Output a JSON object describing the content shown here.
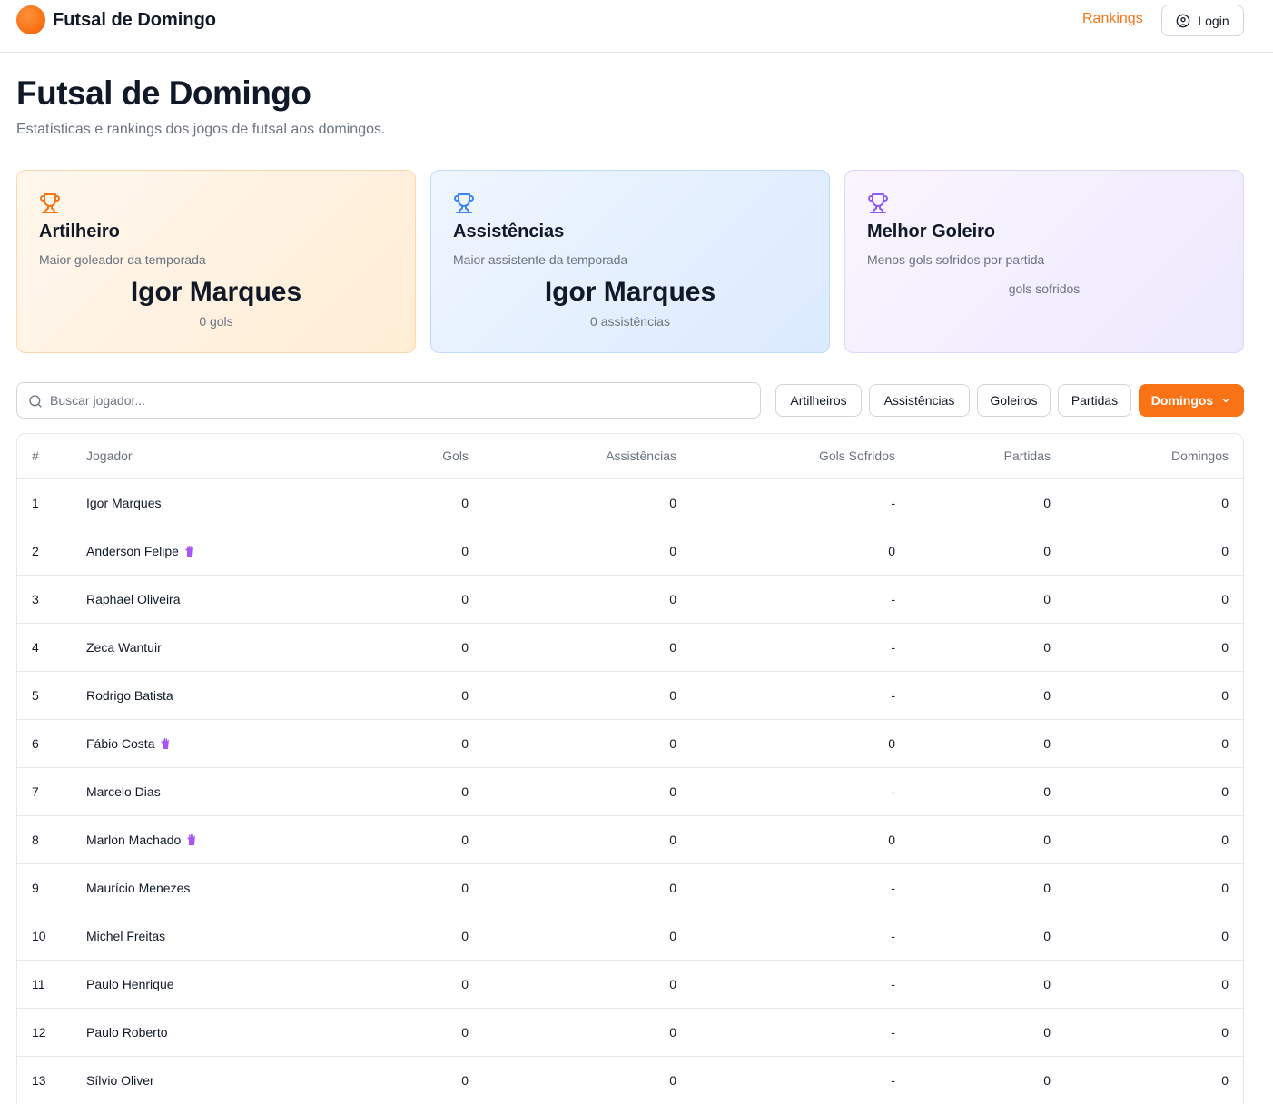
{
  "header": {
    "brand": "Futsal de Domingo",
    "nav_rankings": "Rankings",
    "login_label": "Login"
  },
  "page": {
    "title": "Futsal de Domingo",
    "subtitle": "Estatísticas e rankings dos jogos de futsal aos domingos."
  },
  "cards": {
    "scorer": {
      "title": "Artilheiro",
      "desc": "Maior goleador da temporada",
      "player": "Igor Marques",
      "stat": "0 gols",
      "icon": "trophy-icon",
      "color": "#f97316"
    },
    "assists": {
      "title": "Assistências",
      "desc": "Maior assistente da temporada",
      "player": "Igor Marques",
      "stat": "0 assistências",
      "icon": "trophy-icon",
      "color": "#3b82f6"
    },
    "keeper": {
      "title": "Melhor Goleiro",
      "desc": "Menos gols sofridos por partida",
      "player": "",
      "stat": "gols sofridos",
      "icon": "trophy-icon",
      "color": "#8b5cf6"
    }
  },
  "search": {
    "placeholder": "Buscar jogador..."
  },
  "filters": [
    "Artilheiros",
    "Assistências",
    "Goleiros",
    "Partidas",
    "Domingos"
  ],
  "active_filter": "Domingos",
  "table": {
    "headers": [
      "#",
      "Jogador",
      "Gols",
      "Assistências",
      "Gols Sofridos",
      "Partidas",
      "Domingos"
    ],
    "rows": [
      {
        "rank": "1",
        "name": "Igor Marques",
        "keeper": false,
        "goals": "0",
        "assists": "0",
        "conceded": "-",
        "matches": "0",
        "sundays": "0"
      },
      {
        "rank": "2",
        "name": "Anderson Felipe",
        "keeper": true,
        "goals": "0",
        "assists": "0",
        "conceded": "0",
        "matches": "0",
        "sundays": "0"
      },
      {
        "rank": "3",
        "name": "Raphael Oliveira",
        "keeper": false,
        "goals": "0",
        "assists": "0",
        "conceded": "-",
        "matches": "0",
        "sundays": "0"
      },
      {
        "rank": "4",
        "name": "Zeca Wantuir",
        "keeper": false,
        "goals": "0",
        "assists": "0",
        "conceded": "-",
        "matches": "0",
        "sundays": "0"
      },
      {
        "rank": "5",
        "name": "Rodrigo Batista",
        "keeper": false,
        "goals": "0",
        "assists": "0",
        "conceded": "-",
        "matches": "0",
        "sundays": "0"
      },
      {
        "rank": "6",
        "name": "Fábio Costa",
        "keeper": true,
        "goals": "0",
        "assists": "0",
        "conceded": "0",
        "matches": "0",
        "sundays": "0"
      },
      {
        "rank": "7",
        "name": "Marcelo Dias",
        "keeper": false,
        "goals": "0",
        "assists": "0",
        "conceded": "-",
        "matches": "0",
        "sundays": "0"
      },
      {
        "rank": "8",
        "name": "Marlon Machado",
        "keeper": true,
        "goals": "0",
        "assists": "0",
        "conceded": "0",
        "matches": "0",
        "sundays": "0"
      },
      {
        "rank": "9",
        "name": "Maurício Menezes",
        "keeper": false,
        "goals": "0",
        "assists": "0",
        "conceded": "-",
        "matches": "0",
        "sundays": "0"
      },
      {
        "rank": "10",
        "name": "Michel Freitas",
        "keeper": false,
        "goals": "0",
        "assists": "0",
        "conceded": "-",
        "matches": "0",
        "sundays": "0"
      },
      {
        "rank": "11",
        "name": "Paulo Henrique",
        "keeper": false,
        "goals": "0",
        "assists": "0",
        "conceded": "-",
        "matches": "0",
        "sundays": "0"
      },
      {
        "rank": "12",
        "name": "Paulo Roberto",
        "keeper": false,
        "goals": "0",
        "assists": "0",
        "conceded": "-",
        "matches": "0",
        "sundays": "0"
      },
      {
        "rank": "13",
        "name": "Sílvio Oliver",
        "keeper": false,
        "goals": "0",
        "assists": "0",
        "conceded": "-",
        "matches": "0",
        "sundays": "0"
      }
    ]
  },
  "colors": {
    "accent": "#f97316",
    "glove": "#a855f7"
  }
}
